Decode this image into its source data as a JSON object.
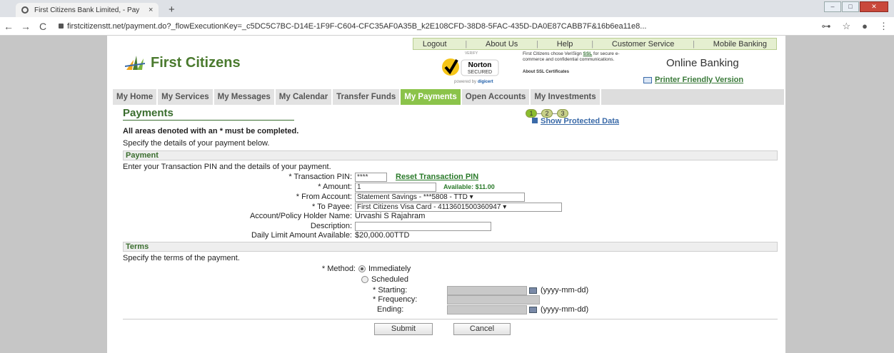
{
  "browser": {
    "tab_title": "First Citizens Bank Limited, - Pay",
    "tab_close": "×",
    "new_tab": "+",
    "url": "firstcitizenstt.net/payment.do?_flowExecutionKey=_c5DC5C7BC-D14E-1F9F-C604-CFC35AF0A35B_k2E108CFD-38D8-5FAC-435D-DA0E87CABB7F&16b6ea11e8...",
    "nav_back": "←",
    "nav_forward": "→",
    "reload": "C",
    "key_icon": "⊶",
    "star_icon": "☆",
    "profile_icon": "●",
    "menu_icon": "⋮",
    "win_min": "–",
    "win_max": "□",
    "win_close": "✕"
  },
  "toplinks": [
    "Logout",
    "About Us",
    "Help",
    "Customer Service",
    "Mobile Banking"
  ],
  "brand": {
    "name": "First Citizens",
    "online_banking": "Online Banking",
    "printer_friendly": "Printer Friendly Version"
  },
  "norton": {
    "verify": "VERIFY",
    "name": "Norton",
    "secured": "SECURED",
    "powered": "powered by",
    "digicert": "digicert"
  },
  "verisign": {
    "line1": "First Citizens chose VeriSign",
    "ssl": "SSL",
    "line2": "for secure e-commerce and confidential communications.",
    "about": "About SSL Certificates"
  },
  "tabs": [
    "My Home",
    "My Services",
    "My Messages",
    "My Calendar",
    "Transfer Funds",
    "My Payments",
    "Open Accounts",
    "My Investments"
  ],
  "active_tab": "My Payments",
  "page": {
    "title": "Payments",
    "steps": [
      "1",
      "2",
      "3"
    ],
    "show_protected": "Show Protected Data",
    "required_note": "All areas denoted with an * must be completed.",
    "spec": "Specify the details of your payment below."
  },
  "payment": {
    "header": "Payment",
    "intro": "Enter your Transaction PIN and the details of your payment.",
    "pin_label": "* Transaction PIN:",
    "pin_value": "****",
    "reset_pin": "Reset Transaction PIN",
    "amount_label": "* Amount:",
    "amount_value": "1",
    "available": "Available: $11.00",
    "from_label": "* From Account:",
    "from_value": "Statement Savings - ***5808 - TTD ▾",
    "to_label": "* To Payee:",
    "to_value": "First Citizens Visa Card - 4113601500360947 ▾",
    "holder_label": "Account/Policy Holder Name:",
    "holder_value": "Urvashi S Rajahram",
    "desc_label": "Description:",
    "desc_value": "",
    "limit_label": "Daily Limit Amount Available:",
    "limit_value": "$20,000.00TTD"
  },
  "terms": {
    "header": "Terms",
    "spec": "Specify the terms of the payment.",
    "method_label": "* Method:",
    "immediately": "Immediately",
    "scheduled": "Scheduled",
    "starting_label": "* Starting:",
    "frequency_label": "* Frequency:",
    "ending_label": "Ending:",
    "date_hint": "(yyyy-mm-dd)"
  },
  "buttons": {
    "submit": "Submit",
    "cancel": "Cancel"
  },
  "colors": {
    "brand_green": "#4a7a2e",
    "tab_active": "#8bc34a",
    "link_green": "#2a7a2a"
  }
}
